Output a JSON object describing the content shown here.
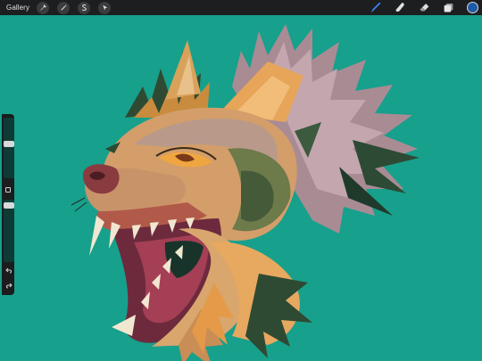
{
  "topbar": {
    "gallery_label": "Gallery",
    "left_tools": [
      {
        "name": "actions",
        "icon": "wrench-icon"
      },
      {
        "name": "adjustments",
        "icon": "magic-wand-icon"
      },
      {
        "name": "selection",
        "icon": "selection-s-icon"
      },
      {
        "name": "transform",
        "icon": "arrow-cursor-icon"
      }
    ],
    "right_tools": [
      {
        "name": "brush",
        "icon": "brush-icon",
        "active": true
      },
      {
        "name": "smudge",
        "icon": "smudge-icon",
        "active": false
      },
      {
        "name": "eraser",
        "icon": "eraser-icon",
        "active": false
      },
      {
        "name": "layers",
        "icon": "layers-icon",
        "active": false
      }
    ],
    "color_swatch": "#1f5aa6",
    "active_tool_color": "#3b82f6"
  },
  "canvas": {
    "background": "#17a08c",
    "artwork": "snarling-wolf-head-illustration"
  },
  "sidebar": {
    "brush_size_level": 0.2,
    "opacity_level": 0.2,
    "undo_icon": "undo-arrow-icon",
    "redo_icon": "redo-arrow-icon"
  }
}
